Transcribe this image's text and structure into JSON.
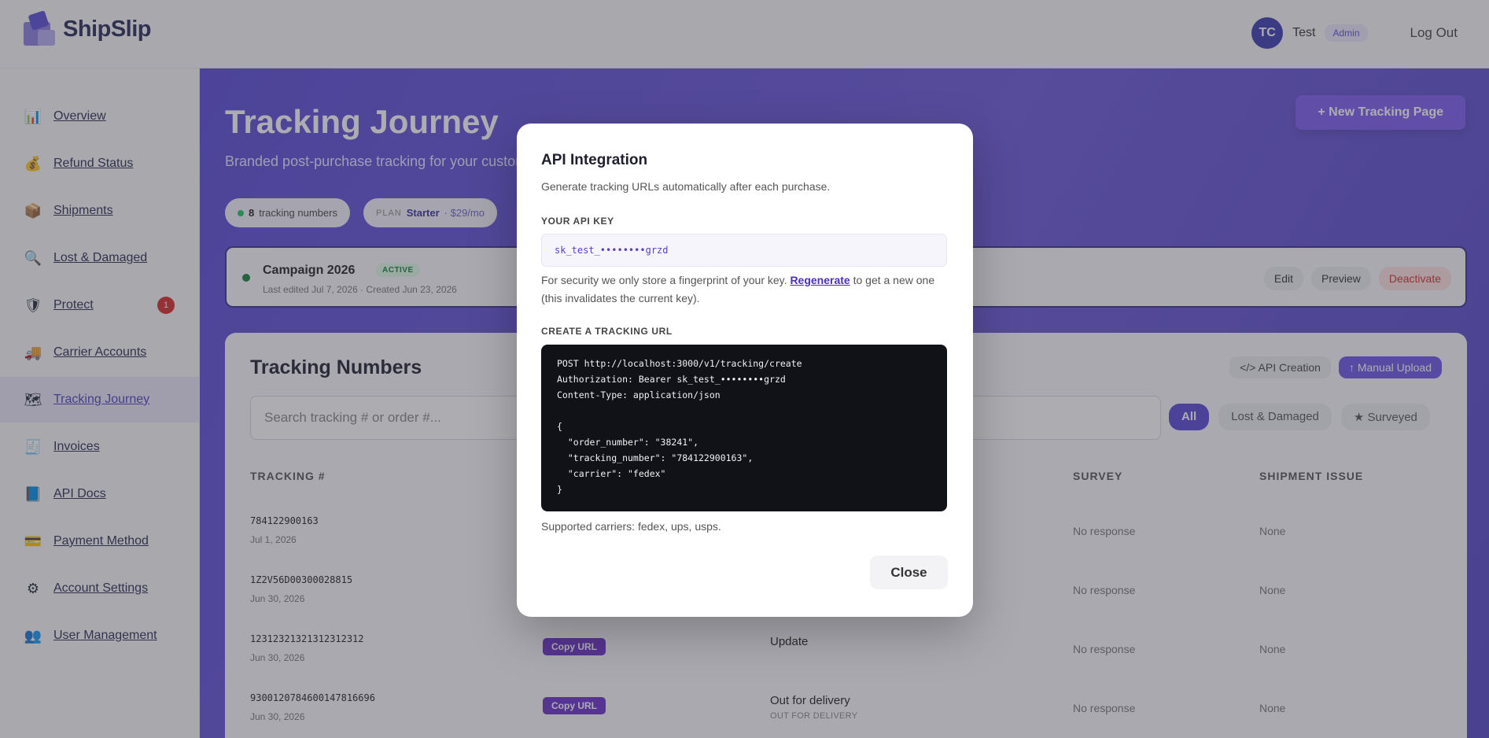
{
  "app": {
    "name": "ShipSlip"
  },
  "user": {
    "initials": "TC",
    "name": "Test",
    "role": "Admin",
    "logout_label": "Log Out"
  },
  "sidebar": {
    "items": [
      {
        "label": "Overview",
        "icon": "chart-icon",
        "glyph": "📊"
      },
      {
        "label": "Refund Status",
        "icon": "money-bag-icon",
        "glyph": "💰"
      },
      {
        "label": "Shipments",
        "icon": "package-icon",
        "glyph": "📦"
      },
      {
        "label": "Lost & Damaged",
        "icon": "magnifier-icon",
        "glyph": "🔍"
      },
      {
        "label": "Protect",
        "icon": "shield-icon",
        "glyph": "🛡",
        "badge": "1"
      },
      {
        "label": "Carrier Accounts",
        "icon": "truck-icon",
        "glyph": "🚚"
      },
      {
        "label": "Tracking Journey",
        "icon": "map-icon",
        "glyph": "🗺",
        "active": true
      },
      {
        "label": "Invoices",
        "icon": "receipt-icon",
        "glyph": "🧾"
      },
      {
        "label": "API Docs",
        "icon": "book-icon",
        "glyph": "📘"
      },
      {
        "label": "Payment Method",
        "icon": "card-icon",
        "glyph": "💳"
      },
      {
        "label": "Account Settings",
        "icon": "gear-icon",
        "glyph": "⚙"
      },
      {
        "label": "User Management",
        "icon": "users-icon",
        "glyph": "👥"
      }
    ]
  },
  "main": {
    "title": "Tracking Journey",
    "subtitle": "Branded post-purchase tracking for your custom",
    "new_button": "+ New Tracking Page",
    "tracking_count": "8",
    "tracking_count_label": "tracking numbers",
    "plan_label": "PLAN",
    "plan_name": "Starter",
    "plan_price": "· $29/mo",
    "campaign": {
      "name": "Campaign 2026",
      "status": "ACTIVE",
      "meta": "Last edited Jul 7, 2026 · Created Jun 23, 2026",
      "edit": "Edit",
      "preview": "Preview",
      "deactivate": "Deactivate"
    },
    "table": {
      "title": "Tracking Numbers",
      "api_creation": "</> API Creation",
      "manual_upload": "↑ Manual Upload",
      "search_placeholder": "Search tracking # or order #...",
      "filters": {
        "all": "All",
        "lost": "Lost & Damaged",
        "surveyed": "★ Surveyed"
      },
      "headers": {
        "tracking": "TRACKING #",
        "survey": "SURVEY",
        "issue": "SHIPMENT ISSUE"
      },
      "copy_label": "Copy URL",
      "rows": [
        {
          "tracking": "784122900163",
          "date": "Jul 1, 2026",
          "status": "",
          "status_sub": "",
          "survey": "No response",
          "issue": "None",
          "copy": false
        },
        {
          "tracking": "1Z2V56D00300028815",
          "date": "Jun 30, 2026",
          "status": "",
          "status_sub": "",
          "survey": "No response",
          "issue": "None",
          "copy": false
        },
        {
          "tracking": "12312321321312312312",
          "date": "Jun 30, 2026",
          "status": "Update",
          "status_sub": "",
          "survey": "No response",
          "issue": "None",
          "copy": true
        },
        {
          "tracking": "9300120784600147816696",
          "date": "Jun 30, 2026",
          "status": "Out for delivery",
          "status_sub": "OUT FOR DELIVERY",
          "survey": "No response",
          "issue": "None",
          "copy": true
        }
      ]
    }
  },
  "modal": {
    "title": "API Integration",
    "subtitle": "Generate tracking URLs automatically after each purchase.",
    "key_label": "YOUR API KEY",
    "key_value": "sk_test_••••••••grzd",
    "security_prefix": "For security we only store a fingerprint of your key.",
    "regenerate": "Regenerate",
    "security_suffix": "to get a new one (this invalidates the current key).",
    "create_label": "CREATE A TRACKING URL",
    "code": "POST http://localhost:3000/v1/tracking/create\nAuthorization: Bearer sk_test_••••••••grzd\nContent-Type: application/json\n\n{\n  \"order_number\": \"38241\",\n  \"tracking_number\": \"784122900163\",\n  \"carrier\": \"fedex\"\n}",
    "carriers": "Supported carriers: fedex, ups, usps.",
    "close": "Close"
  }
}
